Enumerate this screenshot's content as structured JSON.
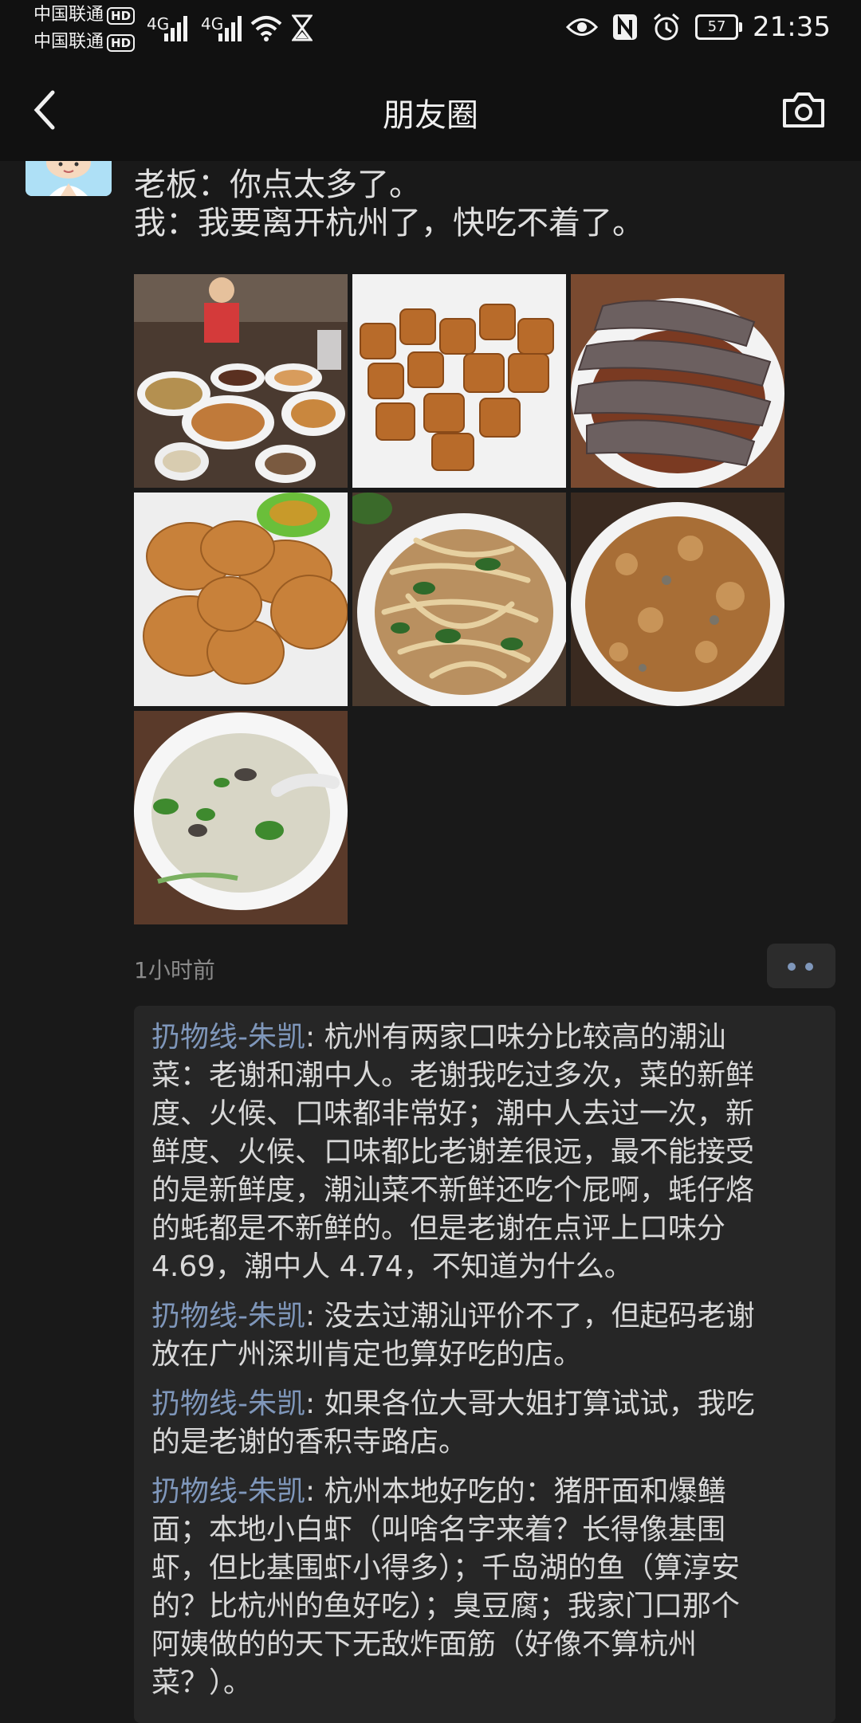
{
  "status_bar": {
    "carrier1": "中国联通",
    "carrier2": "中国联通",
    "hd_badge": "HD",
    "network1": "4G",
    "network2": "4G",
    "battery": "57",
    "time": "21:35"
  },
  "nav": {
    "title": "朋友圈",
    "back_icon": "chevron-left-icon",
    "camera_icon": "camera-icon"
  },
  "post": {
    "text_lines": [
      "老板：你点太多了。",
      "我：我要离开杭州了，快吃不着了。"
    ],
    "timestamp": "1小时前"
  },
  "comments": [
    {
      "author": "扔物线-朱凯",
      "sep": ": ",
      "first_line": "杭州有两家口味分比较高的潮汕",
      "lines": [
        "菜：老谢和潮中人。老谢我吃过多次，菜的新鲜",
        "度、火候、口味都非常好；潮中人去过一次，新",
        "鲜度、火候、口味都比老谢差很远，最不能接受",
        "的是新鲜度，潮汕菜不新鲜还吃个屁啊，蚝仔烙",
        "的蚝都是不新鲜的。但是老谢在点评上口味分",
        "4.69，潮中人 4.74，不知道为什么。"
      ]
    },
    {
      "author": "扔物线-朱凯",
      "sep": ": ",
      "first_line": "没去过潮汕评价不了，但起码老谢",
      "lines": [
        "放在广州深圳肯定也算好吃的店。"
      ]
    },
    {
      "author": "扔物线-朱凯",
      "sep": ": ",
      "first_line": "如果各位大哥大姐打算试试，我吃",
      "lines": [
        "的是老谢的香积寺路店。"
      ]
    },
    {
      "author": "扔物线-朱凯",
      "sep": ": ",
      "first_line": "杭州本地好吃的：猪肝面和爆鳝",
      "lines": [
        "面；本地小白虾（叫啥名字来着？长得像基围",
        "虾，但比基围虾小得多）；千岛湖的鱼（算淳安",
        "的？比杭州的鱼好吃）；臭豆腐；我家门口那个",
        "阿姨做的的天下无敌炸面筋（好像不算杭州",
        "菜？）。"
      ]
    }
  ],
  "colors": {
    "background": "#191919",
    "bar": "#111111",
    "commenter": "#7f97bb",
    "comment_bg": "#262626"
  }
}
